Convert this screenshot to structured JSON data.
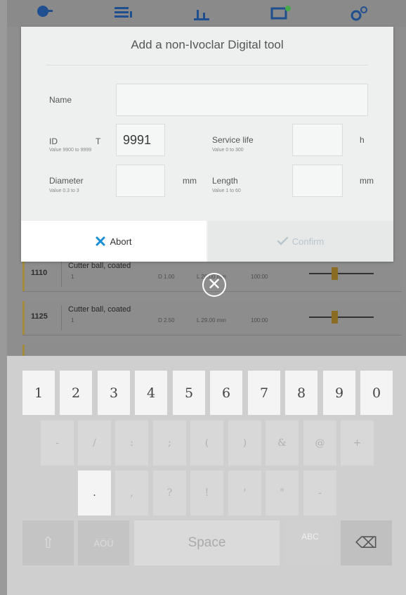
{
  "dialog": {
    "title": "Add a non-Ivoclar Digital tool",
    "name_label": "Name",
    "name_value": "",
    "id_label": "ID",
    "id_prefix": "T",
    "id_hint": "Value 9900 to 9999",
    "id_value": "9991",
    "service_label": "Service life",
    "service_hint": "Value 0 to 300",
    "service_value": "",
    "service_unit": "h",
    "diameter_label": "Diameter",
    "diameter_hint": "Value 0.3 to 3",
    "diameter_value": "",
    "diameter_unit": "mm",
    "length_label": "Length",
    "length_hint": "Value 1 to 60",
    "length_value": "",
    "length_unit": "mm",
    "abort_label": "Abort",
    "confirm_label": "Confirm"
  },
  "tools": [
    {
      "num": "1110",
      "name": "Cutter ball, coated",
      "qty": "1",
      "diameter": "D 1.00",
      "length": "L 20.00 mm",
      "life": "100:00"
    },
    {
      "num": "1125",
      "name": "Cutter ball, coated",
      "qty": "1",
      "diameter": "D 2.50",
      "length": "L 29.00 mm",
      "life": "100:00"
    }
  ],
  "keyboard": {
    "row1": [
      "1",
      "2",
      "3",
      "4",
      "5",
      "6",
      "7",
      "8",
      "9",
      "0"
    ],
    "row2": [
      "-",
      "/",
      ":",
      ";",
      "(",
      ")",
      "&",
      "@",
      "+"
    ],
    "row3": [
      ".",
      ",",
      "?",
      "!",
      "'",
      "\"",
      "-"
    ],
    "shift_label": "⇧",
    "alt_label": "ÄÖÜ",
    "space_label": "Space",
    "abc_label": "ABC",
    "backspace_label": "⌫"
  },
  "colors": {
    "accent": "#1a8fd6",
    "confirm_disabled": "#b8c6cc",
    "tool_marker": "#a58b3c"
  }
}
